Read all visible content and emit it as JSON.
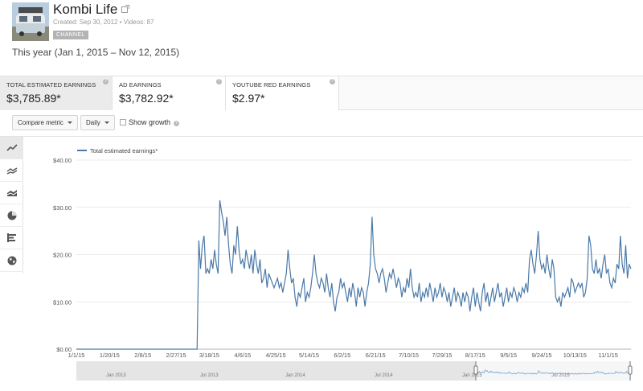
{
  "header": {
    "channel_name": "Kombi Life",
    "meta": "Created: Sep 30, 2012  •  Videos: 87",
    "badge": "CHANNEL",
    "date_range": "This year (Jan 1, 2015 – Nov 12, 2015)"
  },
  "metrics": [
    {
      "label": "TOTAL ESTIMATED EARNINGS",
      "value": "$3,785.89*",
      "active": true
    },
    {
      "label": "AD EARNINGS",
      "value": "$3,782.92*",
      "active": false
    },
    {
      "label": "YOUTUBE RED EARNINGS",
      "value": "$2.97*",
      "active": false
    }
  ],
  "toolbar": {
    "compare_label": "Compare metric",
    "period_label": "Daily",
    "show_growth_label": "Show growth",
    "show_growth_checked": false
  },
  "sidebar": {
    "icons": [
      "line-chart-icon",
      "multi-line-chart-icon",
      "stacked-area-chart-icon",
      "pie-chart-icon",
      "bar-chart-icon",
      "map-globe-icon"
    ],
    "active_index": 0
  },
  "colors": {
    "series": "#4a79a8",
    "nav": "#7fa6cc"
  },
  "nav_labels": [
    "Jan 2013",
    "Jul 2013",
    "Jan 2014",
    "Jul 2014",
    "Jan 2015",
    "Jul 2015"
  ],
  "chart_data": {
    "type": "line",
    "series": [
      {
        "name": "Total estimated earnings*"
      }
    ],
    "x_ticks": [
      "1/1/15",
      "1/20/15",
      "2/8/15",
      "2/27/15",
      "3/18/15",
      "4/6/15",
      "4/25/15",
      "5/14/15",
      "6/2/15",
      "6/21/15",
      "7/10/15",
      "7/29/15",
      "8/17/15",
      "9/5/15",
      "9/24/15",
      "10/13/15",
      "11/1/15"
    ],
    "y_ticks": [
      "$0.00",
      "$10.00",
      "$20.00",
      "$30.00",
      "$40.00"
    ],
    "ylim": [
      0,
      40
    ],
    "x_start": "2015-01-01",
    "x_end": "2015-11-12",
    "points": [
      [
        "2015-01-01",
        0
      ],
      [
        "2015-03-11",
        0
      ],
      [
        "2015-03-12",
        23
      ],
      [
        "2015-03-13",
        17
      ],
      [
        "2015-03-14",
        22
      ],
      [
        "2015-03-15",
        24
      ],
      [
        "2015-03-16",
        16
      ],
      [
        "2015-03-17",
        17
      ],
      [
        "2015-03-18",
        16
      ],
      [
        "2015-03-19",
        19
      ],
      [
        "2015-03-20",
        17
      ],
      [
        "2015-03-21",
        21
      ],
      [
        "2015-03-22",
        18
      ],
      [
        "2015-03-23",
        16
      ],
      [
        "2015-03-24",
        31.5
      ],
      [
        "2015-03-25",
        29
      ],
      [
        "2015-03-26",
        27
      ],
      [
        "2015-03-27",
        24
      ],
      [
        "2015-03-28",
        28
      ],
      [
        "2015-03-29",
        22
      ],
      [
        "2015-03-30",
        18
      ],
      [
        "2015-03-31",
        16
      ],
      [
        "2015-04-01",
        22
      ],
      [
        "2015-04-02",
        20
      ],
      [
        "2015-04-03",
        26
      ],
      [
        "2015-04-04",
        21
      ],
      [
        "2015-04-05",
        18
      ],
      [
        "2015-04-06",
        19
      ],
      [
        "2015-04-07",
        17
      ],
      [
        "2015-04-08",
        21
      ],
      [
        "2015-04-09",
        19
      ],
      [
        "2015-04-10",
        17
      ],
      [
        "2015-04-11",
        20
      ],
      [
        "2015-04-12",
        16
      ],
      [
        "2015-04-13",
        21
      ],
      [
        "2015-04-14",
        18
      ],
      [
        "2015-04-15",
        16
      ],
      [
        "2015-04-16",
        19
      ],
      [
        "2015-04-17",
        14
      ],
      [
        "2015-04-18",
        15
      ],
      [
        "2015-04-19",
        17
      ],
      [
        "2015-04-20",
        13
      ],
      [
        "2015-04-21",
        16
      ],
      [
        "2015-04-22",
        15
      ],
      [
        "2015-04-23",
        14
      ],
      [
        "2015-04-24",
        13
      ],
      [
        "2015-04-25",
        14
      ],
      [
        "2015-04-26",
        15
      ],
      [
        "2015-04-27",
        13
      ],
      [
        "2015-04-28",
        14
      ],
      [
        "2015-04-29",
        12
      ],
      [
        "2015-04-30",
        14
      ],
      [
        "2015-05-01",
        16
      ],
      [
        "2015-05-02",
        21
      ],
      [
        "2015-05-03",
        17
      ],
      [
        "2015-05-04",
        14
      ],
      [
        "2015-05-05",
        15
      ],
      [
        "2015-05-06",
        11
      ],
      [
        "2015-05-07",
        9
      ],
      [
        "2015-05-08",
        12
      ],
      [
        "2015-05-09",
        11
      ],
      [
        "2015-05-10",
        13
      ],
      [
        "2015-05-11",
        15
      ],
      [
        "2015-05-12",
        10
      ],
      [
        "2015-05-13",
        12
      ],
      [
        "2015-05-14",
        11
      ],
      [
        "2015-05-15",
        13
      ],
      [
        "2015-05-16",
        16
      ],
      [
        "2015-05-17",
        20
      ],
      [
        "2015-05-18",
        16
      ],
      [
        "2015-05-19",
        14
      ],
      [
        "2015-05-20",
        13
      ],
      [
        "2015-05-21",
        15
      ],
      [
        "2015-05-22",
        14
      ],
      [
        "2015-05-23",
        12
      ],
      [
        "2015-05-24",
        16
      ],
      [
        "2015-05-25",
        13
      ],
      [
        "2015-05-26",
        11
      ],
      [
        "2015-05-27",
        14
      ],
      [
        "2015-05-28",
        10
      ],
      [
        "2015-05-29",
        8
      ],
      [
        "2015-05-30",
        11
      ],
      [
        "2015-05-31",
        12
      ],
      [
        "2015-06-01",
        15
      ],
      [
        "2015-06-02",
        13
      ],
      [
        "2015-06-03",
        14
      ],
      [
        "2015-06-04",
        12
      ],
      [
        "2015-06-05",
        10
      ],
      [
        "2015-06-06",
        13
      ],
      [
        "2015-06-07",
        11
      ],
      [
        "2015-06-08",
        14
      ],
      [
        "2015-06-09",
        12
      ],
      [
        "2015-06-10",
        9
      ],
      [
        "2015-06-11",
        13
      ],
      [
        "2015-06-12",
        11
      ],
      [
        "2015-06-13",
        13
      ],
      [
        "2015-06-14",
        12
      ],
      [
        "2015-06-15",
        9
      ],
      [
        "2015-06-16",
        12
      ],
      [
        "2015-06-17",
        14
      ],
      [
        "2015-06-18",
        18
      ],
      [
        "2015-06-19",
        28
      ],
      [
        "2015-06-20",
        20
      ],
      [
        "2015-06-21",
        17
      ],
      [
        "2015-06-22",
        16
      ],
      [
        "2015-06-23",
        14
      ],
      [
        "2015-06-24",
        16
      ],
      [
        "2015-06-25",
        17
      ],
      [
        "2015-06-26",
        15
      ],
      [
        "2015-06-27",
        12
      ],
      [
        "2015-06-28",
        14
      ],
      [
        "2015-06-29",
        16
      ],
      [
        "2015-06-30",
        15
      ],
      [
        "2015-07-01",
        17
      ],
      [
        "2015-07-02",
        15
      ],
      [
        "2015-07-03",
        13
      ],
      [
        "2015-07-04",
        15
      ],
      [
        "2015-07-05",
        14
      ],
      [
        "2015-07-06",
        11
      ],
      [
        "2015-07-07",
        13
      ],
      [
        "2015-07-08",
        12
      ],
      [
        "2015-07-09",
        15
      ],
      [
        "2015-07-10",
        13
      ],
      [
        "2015-07-11",
        17
      ],
      [
        "2015-07-12",
        13
      ],
      [
        "2015-07-13",
        11
      ],
      [
        "2015-07-14",
        12
      ],
      [
        "2015-07-15",
        11
      ],
      [
        "2015-07-16",
        14
      ],
      [
        "2015-07-17",
        10
      ],
      [
        "2015-07-18",
        12
      ],
      [
        "2015-07-19",
        11
      ],
      [
        "2015-07-20",
        13
      ],
      [
        "2015-07-21",
        11
      ],
      [
        "2015-07-22",
        14
      ],
      [
        "2015-07-23",
        12
      ],
      [
        "2015-07-24",
        10
      ],
      [
        "2015-07-25",
        13
      ],
      [
        "2015-07-26",
        11
      ],
      [
        "2015-07-27",
        12
      ],
      [
        "2015-07-28",
        14
      ],
      [
        "2015-07-29",
        11
      ],
      [
        "2015-07-30",
        13
      ],
      [
        "2015-07-31",
        12
      ],
      [
        "2015-08-01",
        10
      ],
      [
        "2015-08-02",
        12
      ],
      [
        "2015-08-03",
        9
      ],
      [
        "2015-08-04",
        11
      ],
      [
        "2015-08-05",
        13
      ],
      [
        "2015-08-06",
        10
      ],
      [
        "2015-08-07",
        12
      ],
      [
        "2015-08-08",
        11
      ],
      [
        "2015-08-09",
        9
      ],
      [
        "2015-08-10",
        12
      ],
      [
        "2015-08-11",
        10
      ],
      [
        "2015-08-12",
        12
      ],
      [
        "2015-08-13",
        11
      ],
      [
        "2015-08-14",
        8
      ],
      [
        "2015-08-15",
        11
      ],
      [
        "2015-08-16",
        13
      ],
      [
        "2015-08-17",
        9
      ],
      [
        "2015-08-18",
        12
      ],
      [
        "2015-08-19",
        10
      ],
      [
        "2015-08-20",
        8
      ],
      [
        "2015-08-21",
        12
      ],
      [
        "2015-08-22",
        14
      ],
      [
        "2015-08-23",
        10
      ],
      [
        "2015-08-24",
        12
      ],
      [
        "2015-08-25",
        9
      ],
      [
        "2015-08-26",
        11
      ],
      [
        "2015-08-27",
        13
      ],
      [
        "2015-08-28",
        10
      ],
      [
        "2015-08-29",
        12
      ],
      [
        "2015-08-30",
        14
      ],
      [
        "2015-08-31",
        11
      ],
      [
        "2015-09-01",
        12
      ],
      [
        "2015-09-02",
        9
      ],
      [
        "2015-09-03",
        11
      ],
      [
        "2015-09-04",
        13
      ],
      [
        "2015-09-05",
        10
      ],
      [
        "2015-09-06",
        12
      ],
      [
        "2015-09-07",
        11
      ],
      [
        "2015-09-08",
        13
      ],
      [
        "2015-09-09",
        12
      ],
      [
        "2015-09-10",
        10
      ],
      [
        "2015-09-11",
        12
      ],
      [
        "2015-09-12",
        11
      ],
      [
        "2015-09-13",
        13
      ],
      [
        "2015-09-14",
        12
      ],
      [
        "2015-09-15",
        14
      ],
      [
        "2015-09-16",
        12
      ],
      [
        "2015-09-17",
        19
      ],
      [
        "2015-09-18",
        21
      ],
      [
        "2015-09-19",
        18
      ],
      [
        "2015-09-20",
        16
      ],
      [
        "2015-09-21",
        20
      ],
      [
        "2015-09-22",
        25
      ],
      [
        "2015-09-23",
        19
      ],
      [
        "2015-09-24",
        17
      ],
      [
        "2015-09-25",
        18
      ],
      [
        "2015-09-26",
        16
      ],
      [
        "2015-09-27",
        20
      ],
      [
        "2015-09-28",
        17
      ],
      [
        "2015-09-29",
        15
      ],
      [
        "2015-09-30",
        19
      ],
      [
        "2015-10-01",
        17
      ],
      [
        "2015-10-02",
        11
      ],
      [
        "2015-10-03",
        10
      ],
      [
        "2015-10-04",
        11
      ],
      [
        "2015-10-05",
        9
      ],
      [
        "2015-10-06",
        12
      ],
      [
        "2015-10-07",
        11
      ],
      [
        "2015-10-08",
        12
      ],
      [
        "2015-10-09",
        13
      ],
      [
        "2015-10-10",
        11
      ],
      [
        "2015-10-11",
        15
      ],
      [
        "2015-10-12",
        14
      ],
      [
        "2015-10-13",
        12
      ],
      [
        "2015-10-14",
        13
      ],
      [
        "2015-10-15",
        14
      ],
      [
        "2015-10-16",
        13
      ],
      [
        "2015-10-17",
        14
      ],
      [
        "2015-10-18",
        11
      ],
      [
        "2015-10-19",
        12
      ],
      [
        "2015-10-20",
        15
      ],
      [
        "2015-10-21",
        24
      ],
      [
        "2015-10-22",
        22
      ],
      [
        "2015-10-23",
        17
      ],
      [
        "2015-10-24",
        16
      ],
      [
        "2015-10-25",
        19
      ],
      [
        "2015-10-26",
        16
      ],
      [
        "2015-10-27",
        17
      ],
      [
        "2015-10-28",
        15
      ],
      [
        "2015-10-29",
        18
      ],
      [
        "2015-10-30",
        20
      ],
      [
        "2015-10-31",
        16
      ],
      [
        "2015-11-01",
        17
      ],
      [
        "2015-11-02",
        14
      ],
      [
        "2015-11-03",
        13
      ],
      [
        "2015-11-04",
        15
      ],
      [
        "2015-11-05",
        14
      ],
      [
        "2015-11-06",
        18
      ],
      [
        "2015-11-07",
        17
      ],
      [
        "2015-11-08",
        24
      ],
      [
        "2015-11-09",
        18
      ],
      [
        "2015-11-10",
        16
      ],
      [
        "2015-11-11",
        22
      ],
      [
        "2015-11-12",
        15
      ],
      [
        "2015-11-13",
        18
      ],
      [
        "2015-11-14",
        17
      ]
    ],
    "grid": true,
    "legend_position": "top-left"
  }
}
